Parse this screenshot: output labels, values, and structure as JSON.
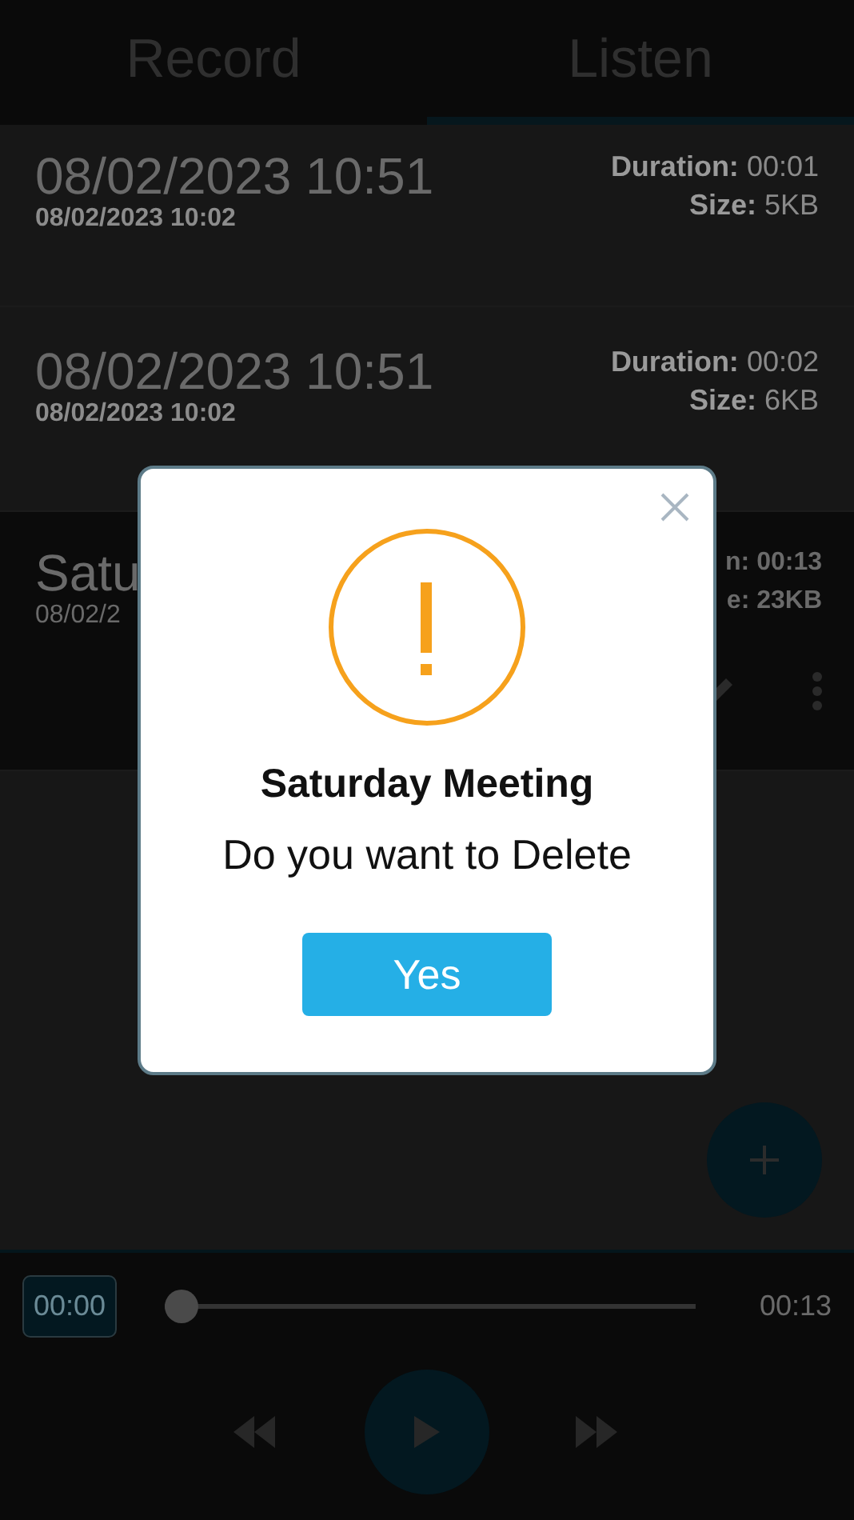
{
  "tabs": [
    {
      "label": "Record",
      "selected": false
    },
    {
      "label": "Listen",
      "selected": true
    }
  ],
  "recordings": [
    {
      "title": "08/02/2023 10:51",
      "date": "08/02/2023 10:02",
      "duration_label": "Duration:",
      "duration": "00:01",
      "size_label": "Size:",
      "size": "5KB",
      "selected": false
    },
    {
      "title": "08/02/2023 10:51",
      "date": "08/02/2023 10:02",
      "duration_label": "Duration:",
      "duration": "00:02",
      "size_label": "Size:",
      "size": "6KB",
      "selected": false
    },
    {
      "title": "Satu",
      "date": "08/02/2",
      "duration": "n: 00:13",
      "size": "e: 23KB",
      "selected": true
    }
  ],
  "player": {
    "current": "00:00",
    "total": "00:13",
    "level": 0
  },
  "dialog": {
    "title": "Saturday Meeting",
    "message": "Do you want to Delete",
    "button": "Yes"
  }
}
